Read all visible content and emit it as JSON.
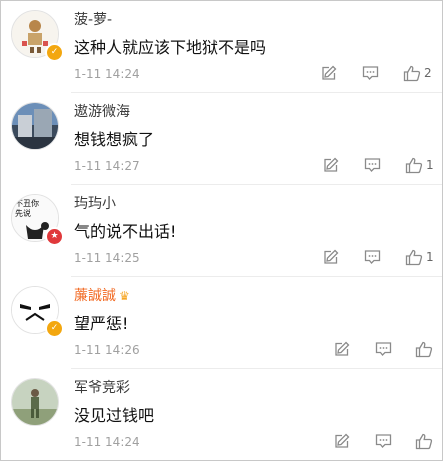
{
  "comments": [
    {
      "user": "菠-萝-",
      "verified": "gold",
      "badge_glyph": "✓",
      "text": "这种人就应该下地狱不是吗",
      "time": "1-11 14:24",
      "likes": "2",
      "avatar_icon": "cartoon-figure-avatar"
    },
    {
      "user": "遨游微海",
      "verified": "",
      "badge_glyph": "",
      "text": "想钱想疯了",
      "time": "1-11 14:27",
      "likes": "1",
      "avatar_icon": "building-photo-avatar"
    },
    {
      "user": "玙玙小",
      "verified": "red",
      "badge_glyph": "★",
      "text": "气的说不出话!",
      "time": "1-11 14:25",
      "likes": "1",
      "avatar_icon": "comic-face-avatar"
    },
    {
      "user": "薕誠誠",
      "verified": "gold",
      "badge_glyph": "✓",
      "vip": true,
      "text": "望严惩!",
      "time": "1-11 14:26",
      "likes": "",
      "avatar_icon": "stormtrooper-avatar"
    },
    {
      "user": "军爷竞彩",
      "verified": "",
      "badge_glyph": "",
      "text": "没见过钱吧",
      "time": "1-11 14:24",
      "likes": "",
      "avatar_icon": "soldier-photo-avatar"
    }
  ],
  "avatar_text": {
    "comment3": "不丑你\n先说"
  },
  "colors": {
    "badge_gold": "#f3a70f",
    "badge_red": "#e0393b",
    "vip_name": "#f26a23",
    "time": "#a0a0a0"
  }
}
